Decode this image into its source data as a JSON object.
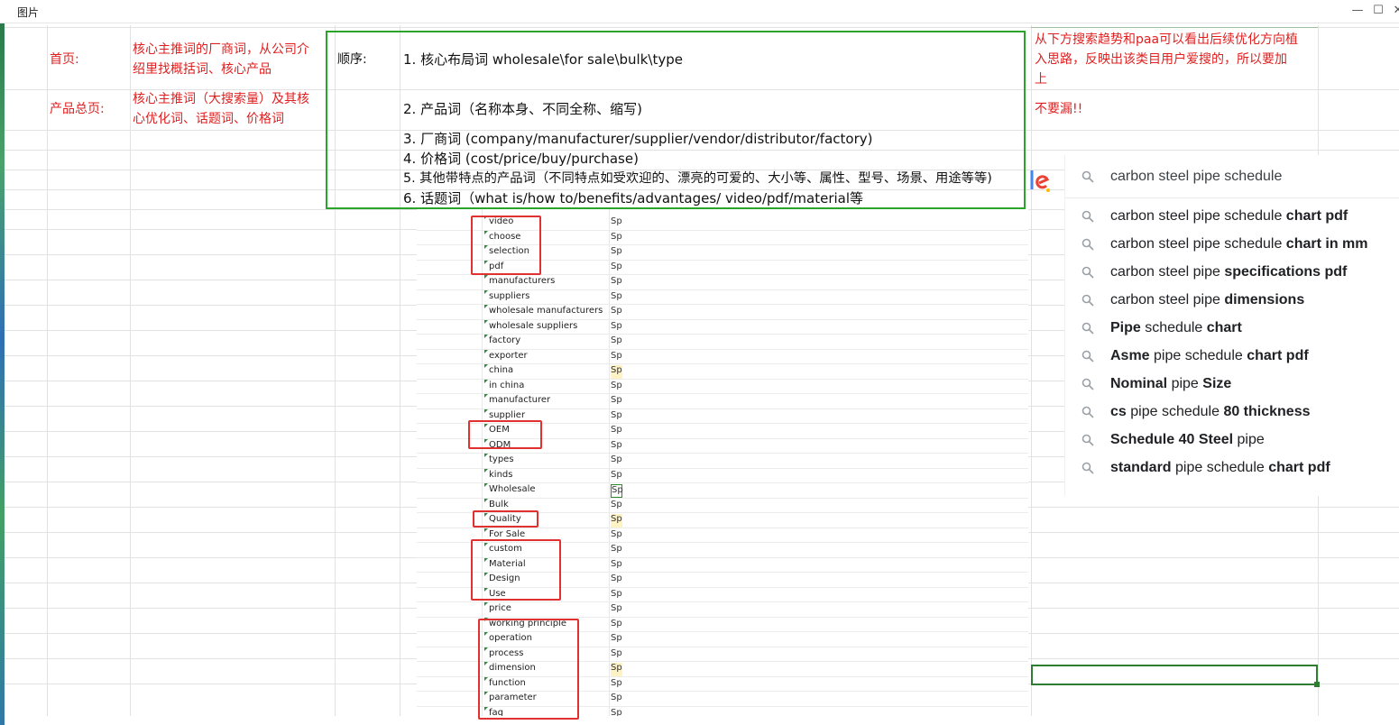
{
  "window": {
    "title": "图片",
    "minimize": "—",
    "maximize": "☐",
    "close": "✕"
  },
  "cells": {
    "homepage_label": "首页:",
    "homepage_desc_1": "核心主推词的厂商词，从公司介",
    "homepage_desc_2": "绍里找概括词、核心产品",
    "product_label": "产品总页:",
    "product_desc_1": "核心主推词（大搜索量）及其核",
    "product_desc_2": "心优化词、话题词、价格词",
    "order_label": "顺序:",
    "order_items": [
      "1. 核心布局词 wholesale\\for sale\\bulk\\type",
      "2. 产品词（名称本身、不同全称、缩写)",
      "3. 厂商词 (company/manufacturer/supplier/vendor/distributor/factory)",
      "4. 价格词 (cost/price/buy/purchase)",
      "5. 其他带特点的产品词（不同特点如受欢迎的、漂亮的可爱的、大小等、属性、型号、场景、用途等等)",
      "6. 话题词（what is/how to/benefits/advantages/ video/pdf/material等"
    ],
    "note_1": "从下方搜索趋势和paa可以看出后续优化方向植",
    "note_2": "入思路，反映出该类目用户爱搜的，所以要加",
    "note_3": "上",
    "note_4": "不要漏!!"
  },
  "keyword_sheet": {
    "column_marker": "Sp",
    "keywords": [
      {
        "text": "video",
        "yellow": false,
        "selected": false
      },
      {
        "text": "choose",
        "yellow": false,
        "selected": false
      },
      {
        "text": "selection",
        "yellow": false,
        "selected": false
      },
      {
        "text": "pdf",
        "yellow": false,
        "selected": false
      },
      {
        "text": "manufacturers",
        "yellow": false,
        "selected": false
      },
      {
        "text": "suppliers",
        "yellow": false,
        "selected": false
      },
      {
        "text": "wholesale manufacturers",
        "yellow": false,
        "selected": false
      },
      {
        "text": "wholesale suppliers",
        "yellow": false,
        "selected": false
      },
      {
        "text": "factory",
        "yellow": false,
        "selected": false
      },
      {
        "text": "exporter",
        "yellow": false,
        "selected": false
      },
      {
        "text": "china",
        "yellow": true,
        "selected": false
      },
      {
        "text": "in china",
        "yellow": false,
        "selected": false
      },
      {
        "text": "manufacturer",
        "yellow": false,
        "selected": false
      },
      {
        "text": "supplier",
        "yellow": false,
        "selected": false
      },
      {
        "text": "OEM",
        "yellow": false,
        "selected": false
      },
      {
        "text": "ODM",
        "yellow": false,
        "selected": false
      },
      {
        "text": "types",
        "yellow": false,
        "selected": false
      },
      {
        "text": "kinds",
        "yellow": false,
        "selected": false
      },
      {
        "text": "Wholesale",
        "yellow": false,
        "selected": true
      },
      {
        "text": "Bulk",
        "yellow": false,
        "selected": false
      },
      {
        "text": "Quality",
        "yellow": true,
        "selected": false
      },
      {
        "text": "For Sale",
        "yellow": false,
        "selected": false
      },
      {
        "text": "custom",
        "yellow": false,
        "selected": false
      },
      {
        "text": "Material",
        "yellow": false,
        "selected": false
      },
      {
        "text": "Design",
        "yellow": false,
        "selected": false
      },
      {
        "text": "Use",
        "yellow": false,
        "selected": false
      },
      {
        "text": "price",
        "yellow": false,
        "selected": false
      },
      {
        "text": "working principle",
        "yellow": false,
        "selected": false
      },
      {
        "text": "operation",
        "yellow": false,
        "selected": false
      },
      {
        "text": "process",
        "yellow": false,
        "selected": false
      },
      {
        "text": "dimension",
        "yellow": true,
        "selected": false
      },
      {
        "text": "function",
        "yellow": false,
        "selected": false
      },
      {
        "text": "parameter",
        "yellow": false,
        "selected": false
      },
      {
        "text": "faq",
        "yellow": false,
        "selected": false
      }
    ]
  },
  "search": {
    "query": "carbon steel pipe schedule",
    "suggestions": [
      [
        {
          "t": "carbon steel pipe schedule ",
          "b": false
        },
        {
          "t": "chart pdf",
          "b": true
        }
      ],
      [
        {
          "t": "carbon steel pipe schedule ",
          "b": false
        },
        {
          "t": "chart in mm",
          "b": true
        }
      ],
      [
        {
          "t": "carbon steel pipe ",
          "b": false
        },
        {
          "t": "specifications pdf",
          "b": true
        }
      ],
      [
        {
          "t": "carbon steel pipe ",
          "b": false
        },
        {
          "t": "dimensions",
          "b": true
        }
      ],
      [
        {
          "t": "Pipe",
          "b": true
        },
        {
          "t": " schedule ",
          "b": false
        },
        {
          "t": "chart",
          "b": true
        }
      ],
      [
        {
          "t": "Asme",
          "b": true
        },
        {
          "t": " pipe schedule ",
          "b": false
        },
        {
          "t": "chart pdf",
          "b": true
        }
      ],
      [
        {
          "t": "Nominal",
          "b": true
        },
        {
          "t": " pipe ",
          "b": false
        },
        {
          "t": "Size",
          "b": true
        }
      ],
      [
        {
          "t": "cs",
          "b": true
        },
        {
          "t": " pipe schedule ",
          "b": false
        },
        {
          "t": "80 thickness",
          "b": true
        }
      ],
      [
        {
          "t": "Schedule 40 Steel",
          "b": true
        },
        {
          "t": " pipe",
          "b": false
        }
      ],
      [
        {
          "t": "standard",
          "b": true
        },
        {
          "t": " pipe schedule ",
          "b": false
        },
        {
          "t": "chart pdf",
          "b": true
        }
      ]
    ]
  },
  "colors": {
    "red_text": "#e02020",
    "green_border": "#2aa52a",
    "red_box": "#e03030"
  }
}
